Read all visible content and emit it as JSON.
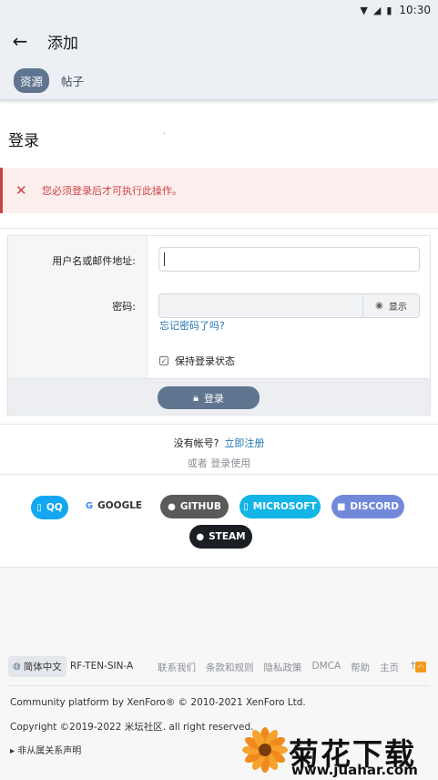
{
  "status_bar": {
    "time": "10:30",
    "icons": [
      "wifi-icon",
      "signal-icon",
      "battery-icon"
    ]
  },
  "app_bar": {
    "title": "添加",
    "back_icon": "arrow-left-icon"
  },
  "tabs": [
    {
      "label": "资源",
      "active": true
    },
    {
      "label": "帖子",
      "active": false
    }
  ],
  "page": {
    "title": "登录"
  },
  "error": {
    "message": "您必须登录后才可执行此操作。",
    "color": "#c84444"
  },
  "form": {
    "username_label": "用户名或邮件地址:",
    "username_value": "",
    "password_label": "密码:",
    "show_label": "显示",
    "forgot_link": "忘记密码了吗?",
    "remember_label": "保持登录状态",
    "remember_checked": true,
    "login_button": "登录"
  },
  "register": {
    "prompt": "没有帐号?",
    "link": "立即注册",
    "or_text": "或者 登录使用"
  },
  "oauth": [
    {
      "label": "QQ",
      "icon": "qq-icon",
      "color": "#12a7f0"
    },
    {
      "label": "GOOGLE",
      "icon": "google-icon",
      "color": "#ffffff"
    },
    {
      "label": "GITHUB",
      "icon": "github-icon",
      "color": "#5a5a5a"
    },
    {
      "label": "MICROSOFT",
      "icon": "microsoft-icon",
      "color": "#13b4e6"
    },
    {
      "label": "DISCORD",
      "icon": "discord-icon",
      "color": "#7289da"
    },
    {
      "label": "STEAM",
      "icon": "steam-icon",
      "color": "#1b1e23"
    }
  ],
  "footer": {
    "language": "简体中文",
    "style": "RF-TEN-SIN-A",
    "links": [
      "联系我们",
      "条款和规则",
      "隐私政策",
      "DMCA",
      "帮助",
      "主页",
      "↑"
    ],
    "line1": "Community platform by XenForo® © 2010-2021 XenForo Ltd.",
    "line2": "Copyright ©2019-2022 米坛社区. all right reserved.",
    "disclaimer": "▸ 非从属关系声明"
  },
  "watermark": {
    "title": "菊花下载网",
    "url": "www.juahar.com"
  }
}
